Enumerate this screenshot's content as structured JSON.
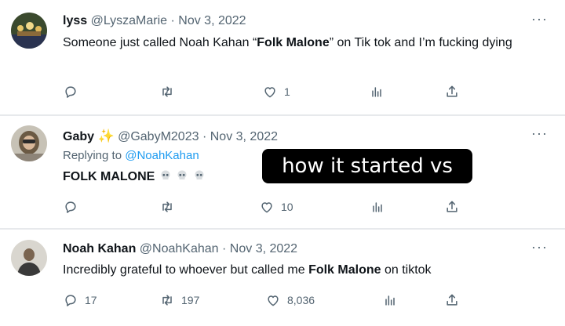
{
  "tweets": [
    {
      "name": "lyss",
      "handle": "@LyszaMarie",
      "sep": "·",
      "date": "Nov 3, 2022",
      "more": "···",
      "text_before": "Someone just called Noah Kahan “",
      "text_bold": "Folk Malone",
      "text_after": "” on Tik tok and I’m fucking dying",
      "replies": "",
      "retweets": "",
      "likes": "1"
    },
    {
      "name": "Gaby",
      "name_emoji": "✨",
      "handle": "@GabyM2023",
      "sep": "·",
      "date": "Nov 3, 2022",
      "more": "···",
      "replying_prefix": "Replying to ",
      "replying_handle": "@NoahKahan",
      "text": "FOLK MALONE",
      "replies": "",
      "retweets": "",
      "likes": "10"
    },
    {
      "name": "Noah Kahan",
      "handle": "@NoahKahan",
      "sep": "·",
      "date": "Nov 3, 2022",
      "more": "···",
      "text_before": "Incredibly grateful to whoever but called me ",
      "text_bold": "Folk Malone",
      "text_after": " on tiktok",
      "replies": "17",
      "retweets": "197",
      "likes": "8,036"
    }
  ],
  "overlay_caption": "how it started vs",
  "colors": {
    "text": "#0f1419",
    "muted": "#536471",
    "link": "#1d9bf0",
    "divider": "#e7e9ec"
  },
  "icons": [
    "reply-icon",
    "retweet-icon",
    "like-icon",
    "views-icon",
    "share-icon",
    "more-icon",
    "skull-emoji"
  ]
}
